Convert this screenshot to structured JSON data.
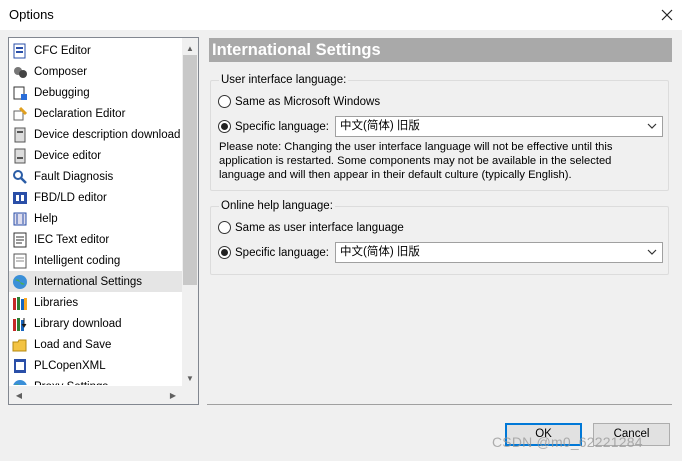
{
  "window": {
    "title": "Options"
  },
  "tree": {
    "items": [
      {
        "label": "CFC Editor",
        "icon": "cfc-editor-icon"
      },
      {
        "label": "Composer",
        "icon": "composer-icon"
      },
      {
        "label": "Debugging",
        "icon": "debugging-icon"
      },
      {
        "label": "Declaration Editor",
        "icon": "declaration-editor-icon"
      },
      {
        "label": "Device description download",
        "icon": "device-download-icon"
      },
      {
        "label": "Device editor",
        "icon": "device-editor-icon"
      },
      {
        "label": "Fault Diagnosis",
        "icon": "fault-diagnosis-icon"
      },
      {
        "label": "FBD/LD editor",
        "icon": "fbd-ld-editor-icon"
      },
      {
        "label": "Help",
        "icon": "help-icon"
      },
      {
        "label": "IEC Text editor",
        "icon": "iec-text-editor-icon"
      },
      {
        "label": "Intelligent coding",
        "icon": "intelligent-coding-icon"
      },
      {
        "label": "International Settings",
        "icon": "globe-icon"
      },
      {
        "label": "Libraries",
        "icon": "libraries-icon"
      },
      {
        "label": "Library download",
        "icon": "library-download-icon"
      },
      {
        "label": "Load and Save",
        "icon": "load-save-icon"
      },
      {
        "label": "PLCopenXML",
        "icon": "plcopenxml-icon"
      },
      {
        "label": "Proxy Settings",
        "icon": "proxy-settings-icon"
      }
    ],
    "selected": "International Settings"
  },
  "panel": {
    "title": "International Settings",
    "ui_language": {
      "label": "User interface language:",
      "option_windows": "Same as Microsoft Windows",
      "option_specific": "Specific language:",
      "selected_option": "specific",
      "language_value": "中文(简体) 旧版",
      "note_lines": [
        "Please note: Changing the user interface language will not be effective until this",
        "application is restarted. Some components may not be available in the selected",
        "language and will then appear in their default culture (typically English)."
      ]
    },
    "help_language": {
      "label": "Online help language:",
      "option_same": "Same as user interface language",
      "option_specific": "Specific language:",
      "selected_option": "specific",
      "language_value": "中文(简体) 旧版"
    }
  },
  "buttons": {
    "ok": "OK",
    "cancel": "Cancel"
  },
  "watermark": "CSDN @m0_62221284",
  "colors": {
    "header_bg": "#a9a9a9",
    "accent": "#0078d7",
    "selection": "#e5e5e5"
  }
}
